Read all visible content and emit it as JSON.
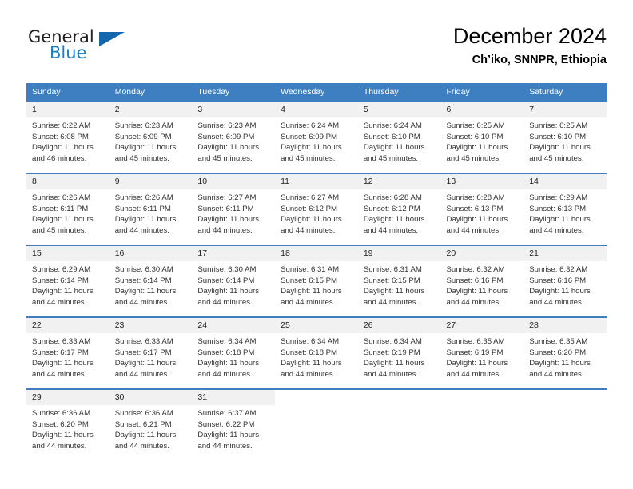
{
  "brand": {
    "line1": "General",
    "line2": "Blue",
    "accent_color": "#1567ad",
    "text_color": "#231f20"
  },
  "header": {
    "title": "December 2024",
    "subtitle": "Ch’iko, SNNPR, Ethiopia"
  },
  "calendar": {
    "header_bg": "#3d7fc1",
    "daynum_bg": "#f1f1f1",
    "weekday_headers": [
      "Sunday",
      "Monday",
      "Tuesday",
      "Wednesday",
      "Thursday",
      "Friday",
      "Saturday"
    ],
    "weeks": [
      [
        {
          "day": "1",
          "sunrise": "Sunrise: 6:22 AM",
          "sunset": "Sunset: 6:08 PM",
          "daylight1": "Daylight: 11 hours",
          "daylight2": "and 46 minutes."
        },
        {
          "day": "2",
          "sunrise": "Sunrise: 6:23 AM",
          "sunset": "Sunset: 6:09 PM",
          "daylight1": "Daylight: 11 hours",
          "daylight2": "and 45 minutes."
        },
        {
          "day": "3",
          "sunrise": "Sunrise: 6:23 AM",
          "sunset": "Sunset: 6:09 PM",
          "daylight1": "Daylight: 11 hours",
          "daylight2": "and 45 minutes."
        },
        {
          "day": "4",
          "sunrise": "Sunrise: 6:24 AM",
          "sunset": "Sunset: 6:09 PM",
          "daylight1": "Daylight: 11 hours",
          "daylight2": "and 45 minutes."
        },
        {
          "day": "5",
          "sunrise": "Sunrise: 6:24 AM",
          "sunset": "Sunset: 6:10 PM",
          "daylight1": "Daylight: 11 hours",
          "daylight2": "and 45 minutes."
        },
        {
          "day": "6",
          "sunrise": "Sunrise: 6:25 AM",
          "sunset": "Sunset: 6:10 PM",
          "daylight1": "Daylight: 11 hours",
          "daylight2": "and 45 minutes."
        },
        {
          "day": "7",
          "sunrise": "Sunrise: 6:25 AM",
          "sunset": "Sunset: 6:10 PM",
          "daylight1": "Daylight: 11 hours",
          "daylight2": "and 45 minutes."
        }
      ],
      [
        {
          "day": "8",
          "sunrise": "Sunrise: 6:26 AM",
          "sunset": "Sunset: 6:11 PM",
          "daylight1": "Daylight: 11 hours",
          "daylight2": "and 45 minutes."
        },
        {
          "day": "9",
          "sunrise": "Sunrise: 6:26 AM",
          "sunset": "Sunset: 6:11 PM",
          "daylight1": "Daylight: 11 hours",
          "daylight2": "and 44 minutes."
        },
        {
          "day": "10",
          "sunrise": "Sunrise: 6:27 AM",
          "sunset": "Sunset: 6:11 PM",
          "daylight1": "Daylight: 11 hours",
          "daylight2": "and 44 minutes."
        },
        {
          "day": "11",
          "sunrise": "Sunrise: 6:27 AM",
          "sunset": "Sunset: 6:12 PM",
          "daylight1": "Daylight: 11 hours",
          "daylight2": "and 44 minutes."
        },
        {
          "day": "12",
          "sunrise": "Sunrise: 6:28 AM",
          "sunset": "Sunset: 6:12 PM",
          "daylight1": "Daylight: 11 hours",
          "daylight2": "and 44 minutes."
        },
        {
          "day": "13",
          "sunrise": "Sunrise: 6:28 AM",
          "sunset": "Sunset: 6:13 PM",
          "daylight1": "Daylight: 11 hours",
          "daylight2": "and 44 minutes."
        },
        {
          "day": "14",
          "sunrise": "Sunrise: 6:29 AM",
          "sunset": "Sunset: 6:13 PM",
          "daylight1": "Daylight: 11 hours",
          "daylight2": "and 44 minutes."
        }
      ],
      [
        {
          "day": "15",
          "sunrise": "Sunrise: 6:29 AM",
          "sunset": "Sunset: 6:14 PM",
          "daylight1": "Daylight: 11 hours",
          "daylight2": "and 44 minutes."
        },
        {
          "day": "16",
          "sunrise": "Sunrise: 6:30 AM",
          "sunset": "Sunset: 6:14 PM",
          "daylight1": "Daylight: 11 hours",
          "daylight2": "and 44 minutes."
        },
        {
          "day": "17",
          "sunrise": "Sunrise: 6:30 AM",
          "sunset": "Sunset: 6:14 PM",
          "daylight1": "Daylight: 11 hours",
          "daylight2": "and 44 minutes."
        },
        {
          "day": "18",
          "sunrise": "Sunrise: 6:31 AM",
          "sunset": "Sunset: 6:15 PM",
          "daylight1": "Daylight: 11 hours",
          "daylight2": "and 44 minutes."
        },
        {
          "day": "19",
          "sunrise": "Sunrise: 6:31 AM",
          "sunset": "Sunset: 6:15 PM",
          "daylight1": "Daylight: 11 hours",
          "daylight2": "and 44 minutes."
        },
        {
          "day": "20",
          "sunrise": "Sunrise: 6:32 AM",
          "sunset": "Sunset: 6:16 PM",
          "daylight1": "Daylight: 11 hours",
          "daylight2": "and 44 minutes."
        },
        {
          "day": "21",
          "sunrise": "Sunrise: 6:32 AM",
          "sunset": "Sunset: 6:16 PM",
          "daylight1": "Daylight: 11 hours",
          "daylight2": "and 44 minutes."
        }
      ],
      [
        {
          "day": "22",
          "sunrise": "Sunrise: 6:33 AM",
          "sunset": "Sunset: 6:17 PM",
          "daylight1": "Daylight: 11 hours",
          "daylight2": "and 44 minutes."
        },
        {
          "day": "23",
          "sunrise": "Sunrise: 6:33 AM",
          "sunset": "Sunset: 6:17 PM",
          "daylight1": "Daylight: 11 hours",
          "daylight2": "and 44 minutes."
        },
        {
          "day": "24",
          "sunrise": "Sunrise: 6:34 AM",
          "sunset": "Sunset: 6:18 PM",
          "daylight1": "Daylight: 11 hours",
          "daylight2": "and 44 minutes."
        },
        {
          "day": "25",
          "sunrise": "Sunrise: 6:34 AM",
          "sunset": "Sunset: 6:18 PM",
          "daylight1": "Daylight: 11 hours",
          "daylight2": "and 44 minutes."
        },
        {
          "day": "26",
          "sunrise": "Sunrise: 6:34 AM",
          "sunset": "Sunset: 6:19 PM",
          "daylight1": "Daylight: 11 hours",
          "daylight2": "and 44 minutes."
        },
        {
          "day": "27",
          "sunrise": "Sunrise: 6:35 AM",
          "sunset": "Sunset: 6:19 PM",
          "daylight1": "Daylight: 11 hours",
          "daylight2": "and 44 minutes."
        },
        {
          "day": "28",
          "sunrise": "Sunrise: 6:35 AM",
          "sunset": "Sunset: 6:20 PM",
          "daylight1": "Daylight: 11 hours",
          "daylight2": "and 44 minutes."
        }
      ],
      [
        {
          "day": "29",
          "sunrise": "Sunrise: 6:36 AM",
          "sunset": "Sunset: 6:20 PM",
          "daylight1": "Daylight: 11 hours",
          "daylight2": "and 44 minutes."
        },
        {
          "day": "30",
          "sunrise": "Sunrise: 6:36 AM",
          "sunset": "Sunset: 6:21 PM",
          "daylight1": "Daylight: 11 hours",
          "daylight2": "and 44 minutes."
        },
        {
          "day": "31",
          "sunrise": "Sunrise: 6:37 AM",
          "sunset": "Sunset: 6:22 PM",
          "daylight1": "Daylight: 11 hours",
          "daylight2": "and 44 minutes."
        },
        {
          "day": "",
          "sunrise": "",
          "sunset": "",
          "daylight1": "",
          "daylight2": ""
        },
        {
          "day": "",
          "sunrise": "",
          "sunset": "",
          "daylight1": "",
          "daylight2": ""
        },
        {
          "day": "",
          "sunrise": "",
          "sunset": "",
          "daylight1": "",
          "daylight2": ""
        },
        {
          "day": "",
          "sunrise": "",
          "sunset": "",
          "daylight1": "",
          "daylight2": ""
        }
      ]
    ]
  }
}
